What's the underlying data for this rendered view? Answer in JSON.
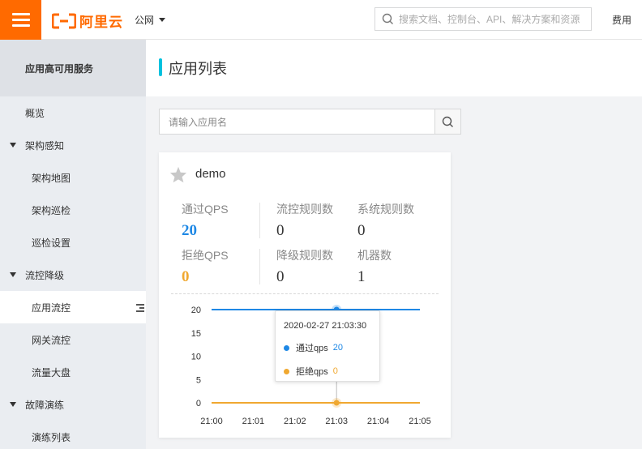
{
  "topbar": {
    "logo_text": "阿里云",
    "region": "公网",
    "search_placeholder": "搜索文档、控制台、API、解决方案和资源",
    "fee": "费用",
    "brand_color": "#ff6a00"
  },
  "sidebar": {
    "header": "应用高可用服务",
    "items": [
      {
        "label": "概览",
        "kind": "top"
      },
      {
        "label": "架构感知",
        "kind": "group"
      },
      {
        "label": "架构地图",
        "kind": "sub"
      },
      {
        "label": "架构巡检",
        "kind": "sub"
      },
      {
        "label": "巡检设置",
        "kind": "sub"
      },
      {
        "label": "流控降级",
        "kind": "group"
      },
      {
        "label": "应用流控",
        "kind": "sub",
        "active": true
      },
      {
        "label": "网关流控",
        "kind": "sub"
      },
      {
        "label": "流量大盘",
        "kind": "sub"
      },
      {
        "label": "故障演练",
        "kind": "group"
      },
      {
        "label": "演练列表",
        "kind": "sub"
      }
    ]
  },
  "main": {
    "title": "应用列表",
    "app_search_placeholder": "请输入应用名"
  },
  "card": {
    "app_name": "demo",
    "metrics": {
      "pass_qps": {
        "label": "通过QPS",
        "value": "20"
      },
      "flow_rules": {
        "label": "流控规则数",
        "value": "0"
      },
      "system_rules": {
        "label": "系统规则数",
        "value": "0"
      },
      "block_qps": {
        "label": "拒绝QPS",
        "value": "0"
      },
      "degrade_rules": {
        "label": "降级规则数",
        "value": "0"
      },
      "machines": {
        "label": "机器数",
        "value": "1"
      }
    }
  },
  "chart_data": {
    "type": "line",
    "x": [
      "21:00",
      "21:01",
      "21:02",
      "21:03",
      "21:04",
      "21:05"
    ],
    "series": [
      {
        "name": "通过qps",
        "color": "#1e88e5",
        "values": [
          20,
          20,
          20,
          20,
          20,
          20
        ]
      },
      {
        "name": "拒绝qps",
        "color": "#f0a830",
        "values": [
          0,
          0,
          0,
          0,
          0,
          0
        ]
      }
    ],
    "yticks": [
      "20",
      "15",
      "10",
      "5",
      "0"
    ],
    "ylim": [
      0,
      20
    ],
    "tooltip": {
      "time": "2020-02-27 21:03:30",
      "items": [
        {
          "name": "通过qps",
          "value": "20",
          "color": "#1e88e5"
        },
        {
          "name": "拒绝qps",
          "value": "0",
          "color": "#f0a830"
        }
      ]
    }
  }
}
